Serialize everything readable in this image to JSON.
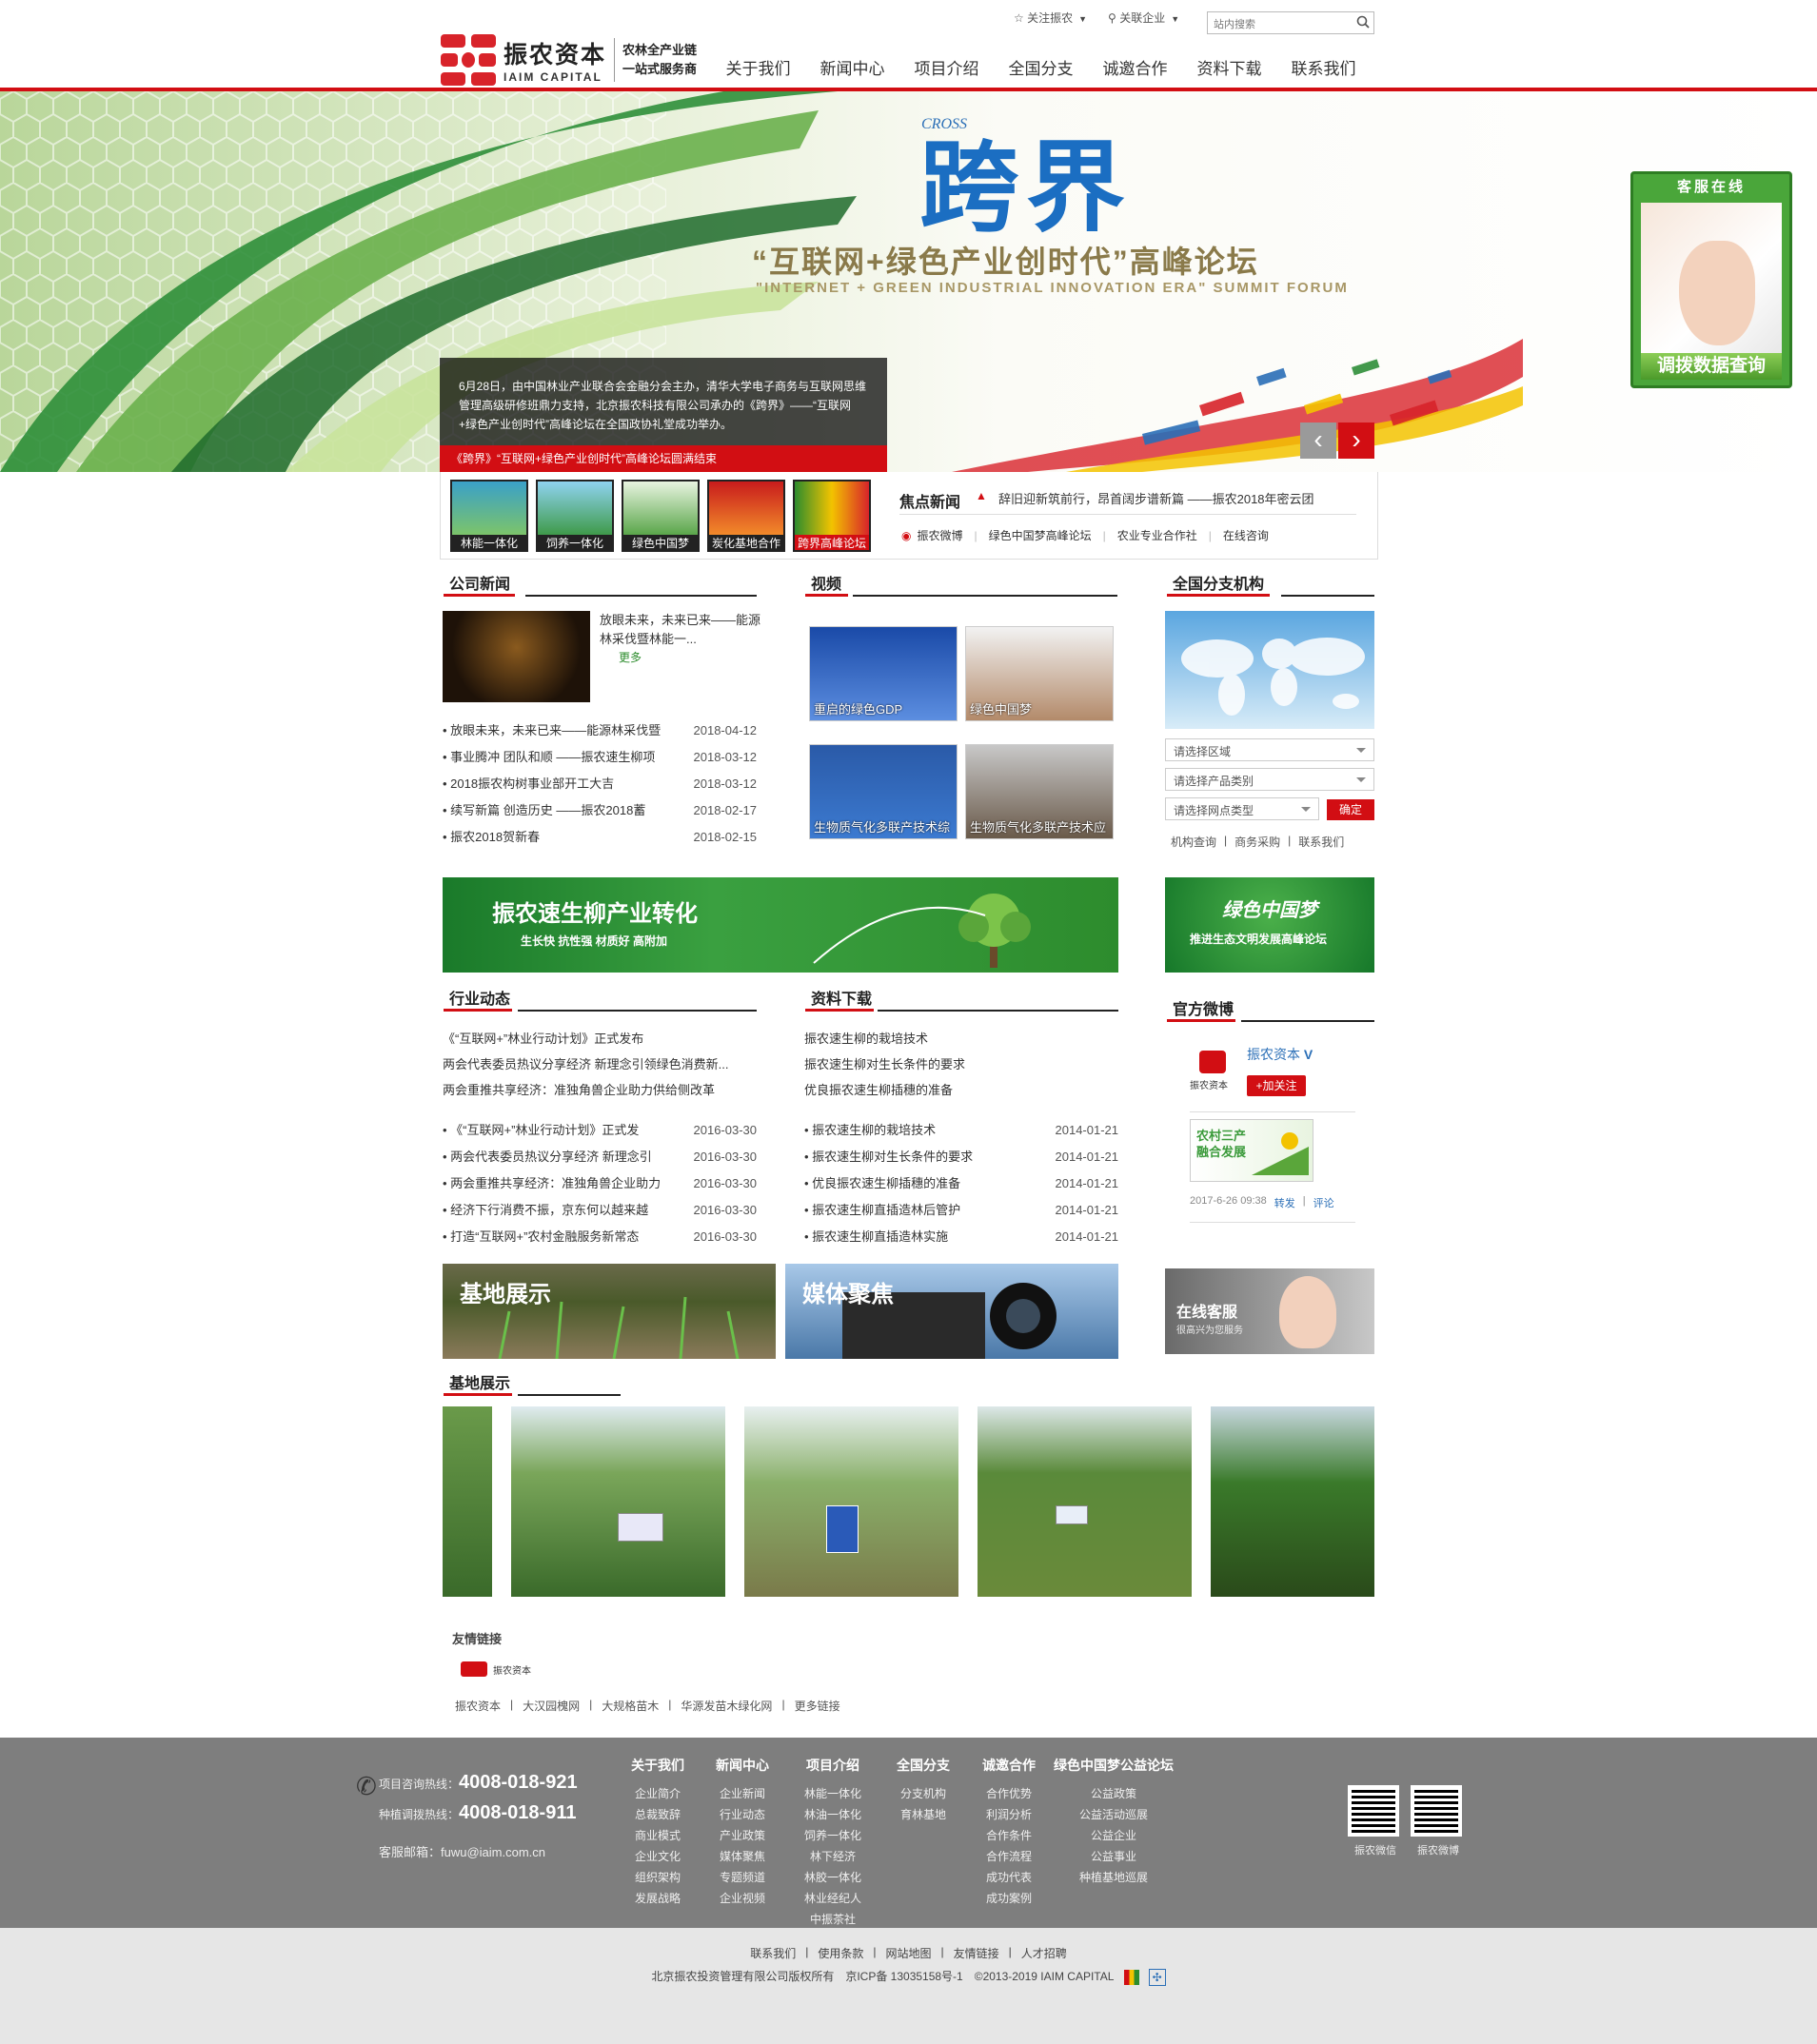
{
  "header": {
    "follow_label": "关注振农",
    "related_label": "关联企业",
    "search_placeholder": "站内搜索",
    "logo_cn": "振农资本",
    "logo_en": "IAIM CAPITAL",
    "slogan_line1": "农林全产业链",
    "slogan_line2": "一站式服务商",
    "nav": [
      "关于我们",
      "新闻中心",
      "项目介绍",
      "全国分支",
      "诚邀合作",
      "资料下载",
      "联系我们"
    ]
  },
  "banner": {
    "cross": "CROSS",
    "title_cn": "跨界",
    "forum_title": "“互联网+绿色产业创时代”高峰论坛",
    "forum_en": "\"INTERNET + GREEN INDUSTRIAL INNOVATION ERA\" SUMMIT FORUM",
    "caption": "6月28日，由中国林业产业联合会金融分会主办，清华大学电子商务与互联网思维管理高级研修班鼎力支持，北京振农科技有限公司承办的《跨界》——“互联网+绿色产业创时代”高峰论坛在全国政协礼堂成功举办。",
    "bar_text": "《跨界》“互联网+绿色产业创时代”高峰论坛圆满结束",
    "prev_arrow": "‹",
    "next_arrow": "›"
  },
  "service_float": {
    "header": "客服在线",
    "button": "调拨数据查询"
  },
  "thumbs": [
    "林能一体化",
    "饲养一体化",
    "绿色中国梦",
    "炭化基地合作",
    "跨界高峰论坛"
  ],
  "focus": {
    "label": "焦点新闻",
    "headline": "辞旧迎新筑前行，昂首阔步谱新篇 ——振农2018年密云团",
    "links": [
      "振农微博",
      "绿色中国梦高峰论坛",
      "农业专业合作社",
      "在线咨询"
    ]
  },
  "company_news": {
    "title": "公司新闻",
    "feature_text": "放眼未来，未来已来——能源林采伐暨林能一...",
    "more": "更多",
    "items": [
      {
        "t": "放眼未来，未来已来——能源林采伐暨",
        "d": "2018-04-12"
      },
      {
        "t": "事业腾冲 团队和顺 ——振农速生柳项",
        "d": "2018-03-12"
      },
      {
        "t": "2018振农构树事业部开工大吉",
        "d": "2018-03-12"
      },
      {
        "t": "续写新篇 创造历史 ——振农2018蓄",
        "d": "2018-02-17"
      },
      {
        "t": "振农2018贺新春",
        "d": "2018-02-15"
      }
    ]
  },
  "video": {
    "title": "视频",
    "items": [
      "重启的绿色GDP",
      "绿色中国梦",
      "生物质气化多联产技术综",
      "生物质气化多联产技术应"
    ]
  },
  "branches": {
    "title": "全国分支机构",
    "select_region": "请选择区域",
    "select_product": "请选择产品类别",
    "select_site": "请选择网点类型",
    "confirm": "确定",
    "links": [
      "机构查询",
      "商务采购",
      "联系我们"
    ]
  },
  "promo": {
    "left_title": "振农速生柳产业转化",
    "left_sub": "生长快 抗性强 材质好 高附加",
    "right_title": "绿色中国梦",
    "right_sub": "推进生态文明发展高峰论坛"
  },
  "industry": {
    "title": "行业动态",
    "top": [
      "《“互联网+”林业行动计划》正式发布",
      "两会代表委员热议分享经济 新理念引领绿色消费新...",
      "两会重推共享经济：准独角兽企业助力供给侧改革"
    ],
    "items": [
      {
        "t": "《“互联网+”林业行动计划》正式发",
        "d": "2016-03-30"
      },
      {
        "t": "两会代表委员热议分享经济 新理念引",
        "d": "2016-03-30"
      },
      {
        "t": "两会重推共享经济：准独角兽企业助力",
        "d": "2016-03-30"
      },
      {
        "t": "经济下行消费不振，京东何以越来越",
        "d": "2016-03-30"
      },
      {
        "t": "打造“互联网+”农村金融服务新常态",
        "d": "2016-03-30"
      }
    ]
  },
  "downloads": {
    "title": "资料下载",
    "top": [
      "振农速生柳的栽培技术",
      "振农速生柳对生长条件的要求",
      "优良振农速生柳插穗的准备"
    ],
    "items": [
      {
        "t": "振农速生柳的栽培技术",
        "d": "2014-01-21"
      },
      {
        "t": "振农速生柳对生长条件的要求",
        "d": "2014-01-21"
      },
      {
        "t": "优良振农速生柳插穗的准备",
        "d": "2014-01-21"
      },
      {
        "t": "振农速生柳直插造林后管护",
        "d": "2014-01-21"
      },
      {
        "t": "振农速生柳直插造林实施",
        "d": "2014-01-21"
      }
    ]
  },
  "weibo": {
    "title": "官方微博",
    "name": "振农资本",
    "v": "V",
    "follow": "+加关注",
    "post_img_text": "农村三产融合发展",
    "time": "2017-6-26 09:38",
    "repost": "转发",
    "comment": "评论"
  },
  "banners2": {
    "base": "基地展示",
    "media": "媒体聚焦",
    "online": "在线客服",
    "online_sub": "很高兴为您服务"
  },
  "base_show": {
    "title": "基地展示"
  },
  "friend_links": {
    "title": "友情链接",
    "items": [
      "振农资本",
      "大汉园槐网",
      "大规格苗木",
      "华源发苗木绿化网",
      "更多链接"
    ]
  },
  "footer": {
    "hotline1_label": "项目咨询热线：",
    "hotline1": "4008-018-921",
    "hotline2_label": "种植调拨热线：",
    "hotline2": "4008-018-911",
    "email": "客服邮箱：fuwu@iaim.com.cn",
    "cols": [
      {
        "h": "关于我们",
        "items": [
          "企业简介",
          "总裁致辞",
          "商业模式",
          "企业文化",
          "组织架构",
          "发展战略"
        ]
      },
      {
        "h": "新闻中心",
        "items": [
          "企业新闻",
          "行业动态",
          "产业政策",
          "媒体聚焦",
          "专题频道",
          "企业视频"
        ]
      },
      {
        "h": "项目介绍",
        "items": [
          "林能一体化",
          "林油一体化",
          "饲养一体化",
          "林下经济",
          "林胶一体化",
          "林业经纪人",
          "中振茶社"
        ]
      },
      {
        "h": "全国分支",
        "items": [
          "分支机构",
          "育林基地"
        ]
      },
      {
        "h": "诚邀合作",
        "items": [
          "合作优势",
          "利润分析",
          "合作条件",
          "合作流程",
          "成功代表",
          "成功案例"
        ]
      },
      {
        "h": "绿色中国梦公益论坛",
        "items": [
          "公益政策",
          "公益活动巡展",
          "公益企业",
          "公益事业",
          "种植基地巡展"
        ]
      }
    ],
    "qr1": "振农微信",
    "qr2": "振农微博",
    "bottom_links": [
      "联系我们",
      "使用条款",
      "网站地图",
      "友情链接",
      "人才招聘"
    ],
    "copyright": "北京振农投资管理有限公司版权所有　京ICP备 13035158号-1　©2013-2019 IAIM CAPITAL"
  },
  "colors": {
    "brand_red": "#d20e13",
    "brand_green": "#2d8c2d",
    "footer_gray": "#7e7e7e"
  }
}
